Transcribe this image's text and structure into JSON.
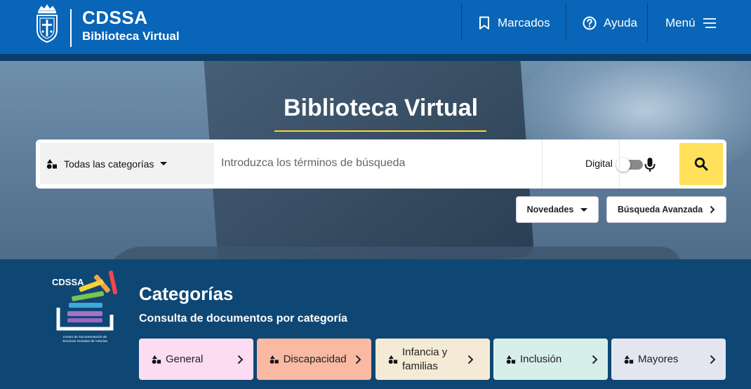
{
  "header": {
    "brand_title": "CDSSA",
    "brand_subtitle": "Biblioteca Virtual",
    "nav": [
      {
        "label": "Marcados",
        "icon": "bookmark-icon"
      },
      {
        "label": "Ayuda",
        "icon": "help-icon"
      },
      {
        "label": "Menú",
        "icon": "hamburger-icon"
      }
    ]
  },
  "hero": {
    "title": "Biblioteca Virtual"
  },
  "search": {
    "category_label": "Todas las categorías",
    "placeholder": "Introduzca los términos de búsqueda",
    "value": "",
    "digital_label": "Digital",
    "digital_on": false
  },
  "actions": {
    "novedades_label": "Novedades",
    "advanced_label": "Búsqueda Avanzada"
  },
  "categories": {
    "logo_text": "CDSSA",
    "logo_caption": "Centro de Documentación de Servicios Sociales de Asturias",
    "title": "Categorías",
    "subtitle": "Consulta de documentos por categoría",
    "items": [
      {
        "label": "General",
        "color": "#fcdcf2"
      },
      {
        "label": "Discapacidad",
        "color": "#f9b9a3"
      },
      {
        "label": "Infancia y familias",
        "color": "#f5ead5"
      },
      {
        "label": "Inclusión",
        "color": "#d6efea"
      },
      {
        "label": "Mayores",
        "color": "#e3e6f1"
      }
    ]
  },
  "colors": {
    "header_bg": "#0865b8",
    "accent_yellow": "#ffe15c",
    "categories_bg": "#0e4774"
  }
}
